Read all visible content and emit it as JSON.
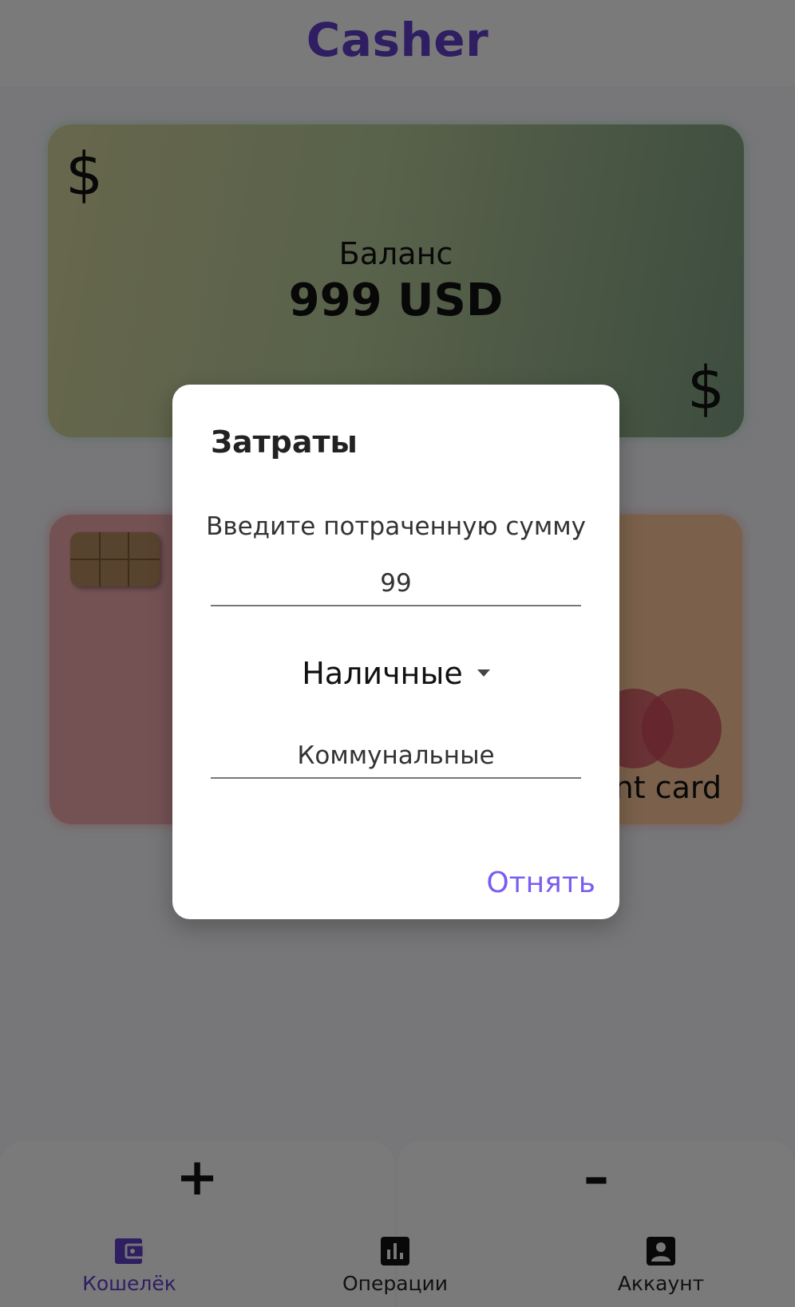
{
  "app": {
    "title": "Casher"
  },
  "balance_card": {
    "label": "Баланс",
    "value": "999 USD",
    "currency_symbol": "$"
  },
  "payment_card": {
    "name_fragment": "nt card"
  },
  "actions": {
    "add_label": "+",
    "subtract_label": "–"
  },
  "nav": {
    "items": [
      {
        "label": "Кошелёк",
        "icon": "wallet-icon",
        "active": true
      },
      {
        "label": "Операции",
        "icon": "chart-icon",
        "active": false
      },
      {
        "label": "Аккаунт",
        "icon": "account-icon",
        "active": false
      }
    ]
  },
  "dialog": {
    "title": "Затраты",
    "prompt": "Введите потраченную сумму",
    "amount_value": "99",
    "type_selected": "Наличные",
    "category_value": "Коммунальные",
    "confirm_label": "Отнять"
  },
  "colors": {
    "accent": "#5f3dc4",
    "dialog_button": "#7b5cf0"
  }
}
